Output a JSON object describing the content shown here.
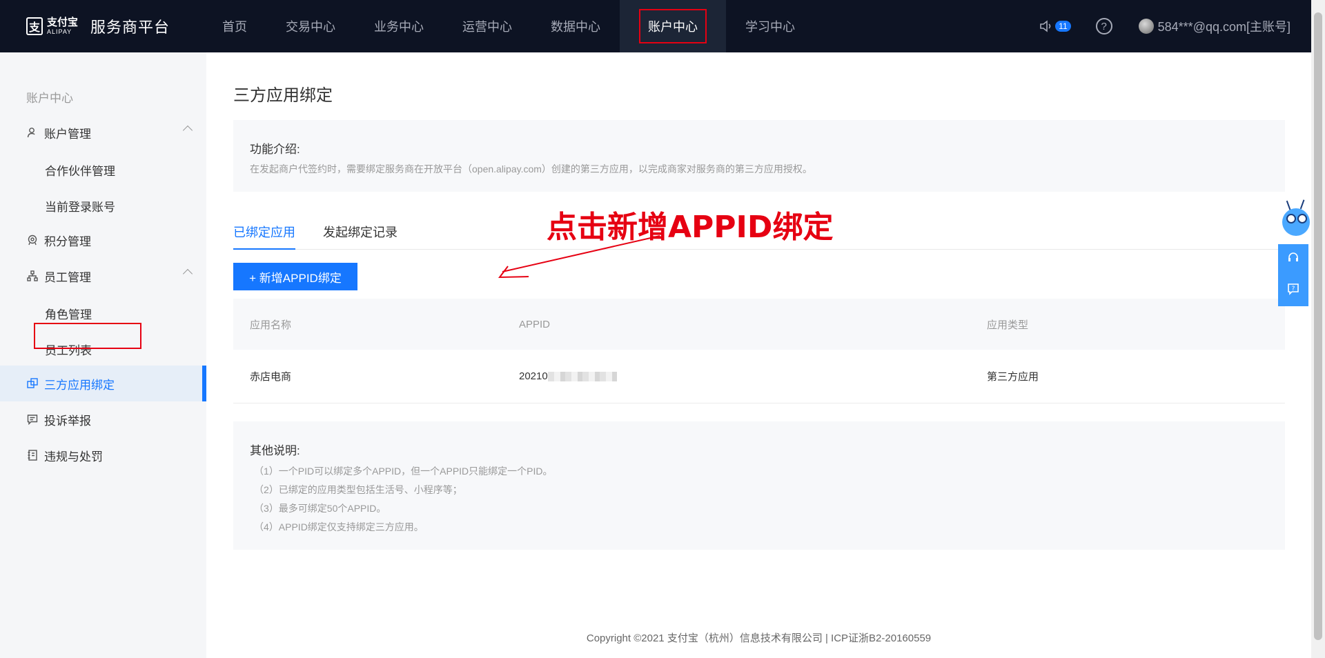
{
  "header": {
    "logo_cn": "支付宝",
    "logo_en": "ALIPAY",
    "platform_name": "服务商平台",
    "nav": [
      {
        "label": "首页"
      },
      {
        "label": "交易中心"
      },
      {
        "label": "业务中心"
      },
      {
        "label": "运营中心"
      },
      {
        "label": "数据中心"
      },
      {
        "label": "账户中心",
        "active": true
      },
      {
        "label": "学习中心"
      }
    ],
    "notification_count": "11",
    "help_icon": "question-circle-icon",
    "account": "584***@qq.com[主账号]"
  },
  "sidebar": {
    "title": "账户中心",
    "items": [
      {
        "label": "账户管理",
        "icon": "user-icon"
      },
      {
        "label": "合作伙伴管理"
      },
      {
        "label": "当前登录账号"
      },
      {
        "label": "积分管理",
        "icon": "points-icon"
      },
      {
        "label": "员工管理",
        "icon": "org-chart-icon"
      },
      {
        "label": "角色管理"
      },
      {
        "label": "员工列表"
      },
      {
        "label": "三方应用绑定",
        "icon": "link-app-icon",
        "active": true
      },
      {
        "label": "投诉举报",
        "icon": "report-icon"
      },
      {
        "label": "违规与处罚",
        "icon": "penalty-icon"
      }
    ]
  },
  "main": {
    "page_title": "三方应用绑定",
    "intro_heading": "功能介绍:",
    "intro_text": "在发起商户代签约时，需要绑定服务商在开放平台（open.alipay.com）创建的第三方应用，以完成商家对服务商的第三方应用授权。",
    "tabs": [
      {
        "label": "已绑定应用",
        "active": true
      },
      {
        "label": "发起绑定记录"
      }
    ],
    "annotation": "点击新增APPID绑定",
    "add_button": "+ 新增APPID绑定",
    "table": {
      "headers": [
        "应用名称",
        "APPID",
        "应用类型"
      ],
      "rows": [
        {
          "name": "赤店电商",
          "appid": "20210",
          "type": "第三方应用"
        }
      ]
    },
    "notes_heading": "其他说明:",
    "notes": [
      "（1）一个PID可以绑定多个APPID，但一个APPID只能绑定一个PID。",
      "（2）已绑定的应用类型包括生活号、小程序等；",
      "（3）最多可绑定50个APPID。",
      "（4）APPID绑定仅支持绑定三方应用。"
    ],
    "footer": "Copyright ©2021 支付宝（杭州）信息技术有限公司  |  ICP证浙B2-20160559"
  },
  "colors": {
    "header_bg": "#0d1323",
    "accent": "#1677ff",
    "highlight_red": "#e60012"
  }
}
